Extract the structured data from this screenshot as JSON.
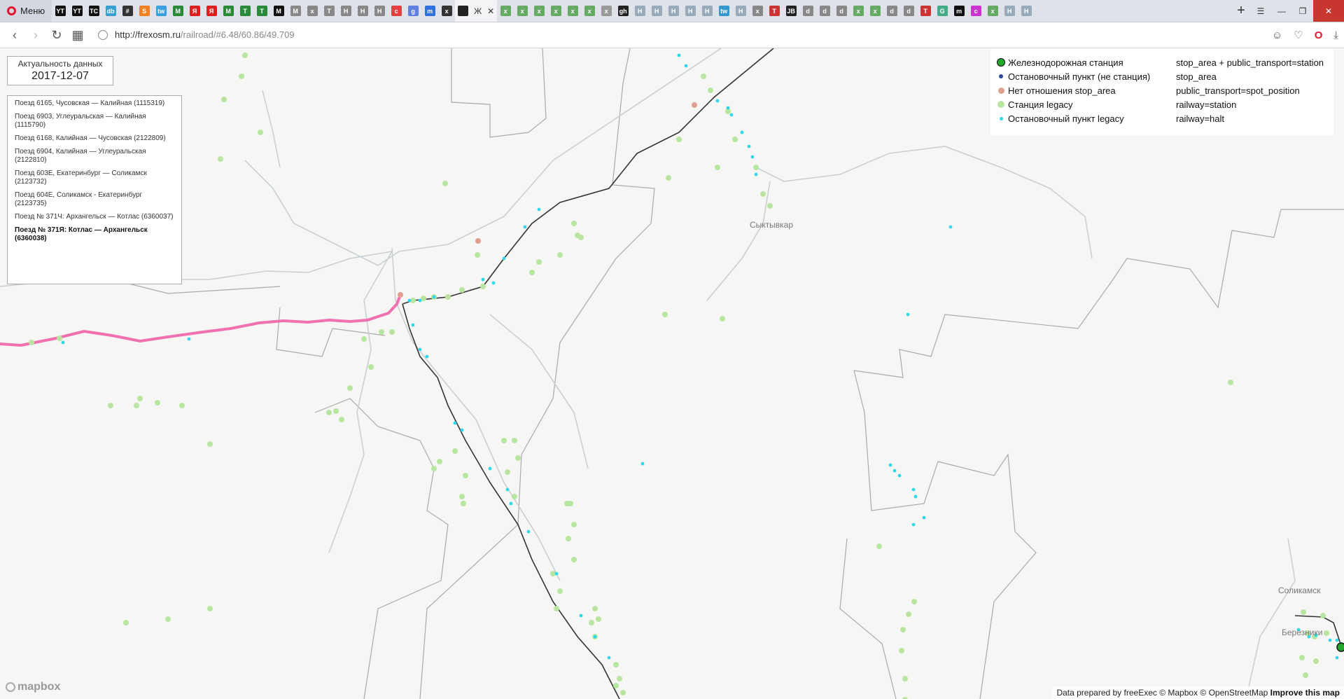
{
  "browser": {
    "menu_label": "Меню",
    "active_tab_label": "Ж",
    "url_host": "http://frexosm.ru",
    "url_path": "/railroad/#6.48/60.86/49.709",
    "tab_icons": [
      "YT",
      "YT",
      "TC",
      "db",
      "#",
      "S",
      "tw",
      "M",
      "Я",
      "Я",
      "M",
      "T",
      "T",
      "M",
      "M",
      "x",
      "T",
      "H",
      "H",
      "H",
      "c",
      "g",
      "m",
      "x"
    ],
    "tab_icons_right": [
      "x",
      "x",
      "x",
      "x",
      "x",
      "x",
      "x",
      "gh",
      "H",
      "H",
      "H",
      "H",
      "H",
      "tw",
      "H",
      "x",
      "T",
      "JB",
      "d",
      "d",
      "d",
      "x",
      "x",
      "d",
      "d",
      "T",
      "G",
      "m",
      "c",
      "x",
      "H",
      "H"
    ]
  },
  "map": {
    "freshness_label": "Актуальность данных",
    "freshness_date": "2017-12-07",
    "routes": [
      "Поезд 6165, Чусовская — Калийная (1115319)",
      "Поезд 6903, Углеуральская — Калийная (1115790)",
      "Поезд 6168, Калийная — Чусовская (2122809)",
      "Поезд 6904, Калийная — Углеуральская (2122810)",
      "Поезд 603Е, Екатеринбург — Соликамск (2123732)",
      "Поезд 604Е, Соликамск - Екатеринбург (2123735)",
      "Поезд № 371Ч: Архангельск — Котлас (6360037)",
      "Поезд № 371Я: Котлас — Архангельск (6360038)"
    ],
    "selected_route_index": 7,
    "legend": [
      {
        "label": "Железнодорожная станция",
        "tag": "stop_area + public_transport=station",
        "color": "#22a82c"
      },
      {
        "label": "Остановочный пункт (не станция)",
        "tag": "stop_area",
        "color": "#2c4aa0"
      },
      {
        "label": "Нет отношения stop_area",
        "tag": "public_transport=spot_position",
        "color": "#e0a090"
      },
      {
        "label": "Станция legacy",
        "tag": "railway=station",
        "color": "#b8e6a0"
      },
      {
        "label": "Остановочный пункт legacy",
        "tag": "railway=halt",
        "color": "#30d8e8"
      }
    ],
    "cities": [
      "Сыктывкар",
      "Соликамск",
      "Березники"
    ],
    "attribution_prefix": "Data prepared by freeExec © Mapbox © OpenStreetMap",
    "attribution_link": "Improve this map",
    "logo": "mapbox",
    "colors": {
      "route_highlight": "#f070b0",
      "railway": "#333333",
      "river": "#c8d0d4",
      "border": "#a8a8a8"
    }
  }
}
